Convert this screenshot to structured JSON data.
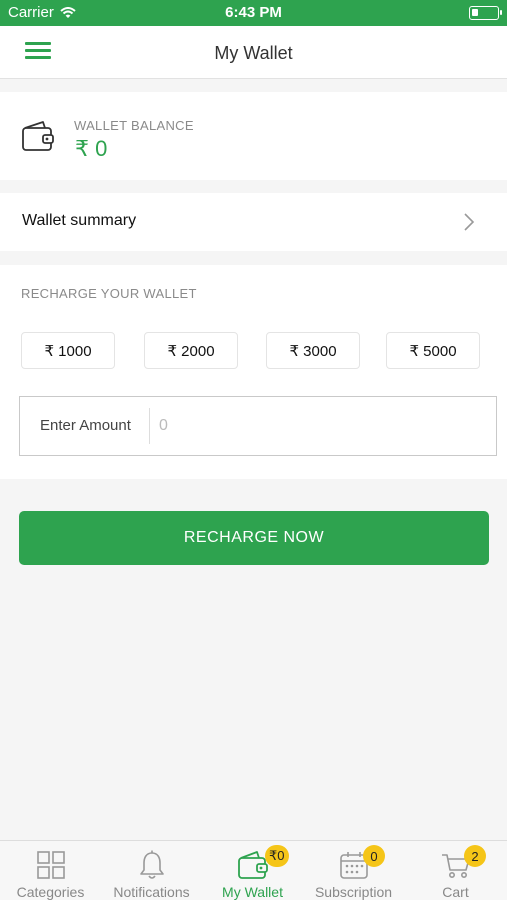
{
  "status_bar": {
    "carrier": "Carrier",
    "time": "6:43 PM"
  },
  "header": {
    "title": "My Wallet"
  },
  "balance": {
    "label": "WALLET BALANCE",
    "amount": "₹ 0"
  },
  "summary": {
    "label": "Wallet summary"
  },
  "recharge": {
    "heading": "RECHARGE YOUR WALLET",
    "chips": [
      "₹ 1000",
      "₹ 2000",
      "₹ 3000",
      "₹ 5000"
    ],
    "input_label": "Enter Amount",
    "input_placeholder": "0",
    "button_label": "RECHARGE NOW"
  },
  "tabs": [
    {
      "label": "Categories",
      "icon": "grid-icon",
      "active": false
    },
    {
      "label": "Notifications",
      "icon": "bell-icon",
      "active": false
    },
    {
      "label": "My Wallet",
      "icon": "wallet-icon",
      "active": true,
      "badge": "₹0"
    },
    {
      "label": "Subscription",
      "icon": "calendar-icon",
      "active": false,
      "badge": "0"
    },
    {
      "label": "Cart",
      "icon": "cart-icon",
      "active": false,
      "badge": "2"
    }
  ],
  "colors": {
    "accent": "#2ea34f",
    "badge": "#f5c518"
  }
}
